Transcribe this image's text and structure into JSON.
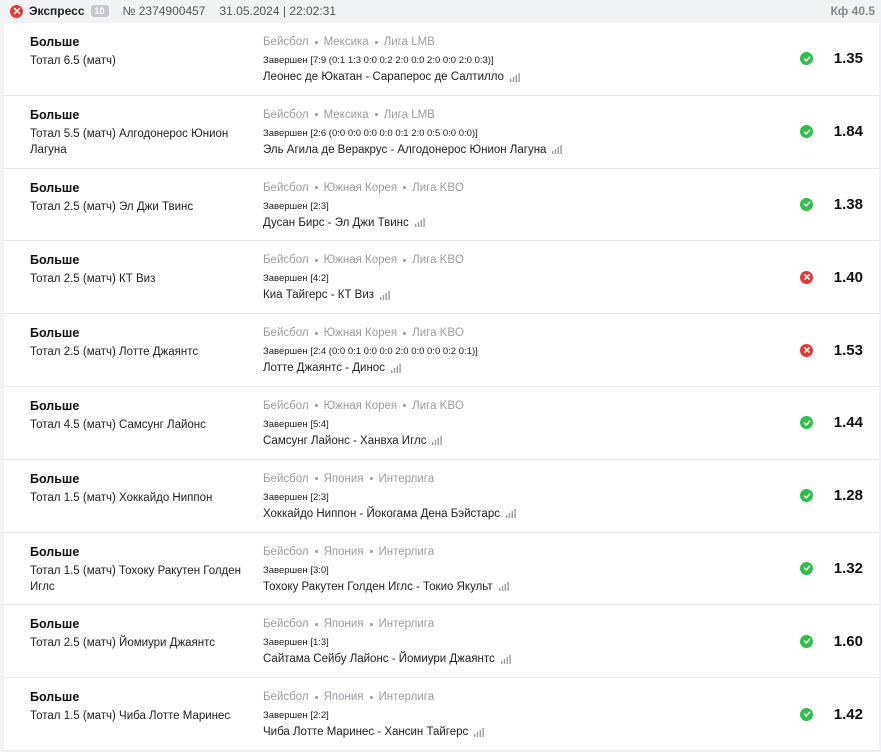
{
  "header": {
    "status": "lost",
    "type": "Экспресс",
    "count": "10",
    "number": "№ 2374900457",
    "datetime": "31.05.2024 | 22:02:31",
    "kf": "Кф 40.5"
  },
  "colors": {
    "won": "#2fbf4a",
    "lost": "#e53935"
  },
  "icons": {
    "won": "check-icon",
    "lost": "cross-icon",
    "stats": "bar-chart-icon"
  },
  "bets": [
    {
      "type": "Больше",
      "desc": "Тотал 6.5 (матч)",
      "sport": "Бейсбол",
      "country": "Мексика",
      "league": "Лига LMB",
      "result": "Завершен [7:9 (0:1 1:3 0:0 0:2 2:0 0:0 2:0 0:0 2:0 0:3)]",
      "teams": "Леонес де Юкатан - Сарaперос де Салтилло",
      "status": "won",
      "coef": "1.35"
    },
    {
      "type": "Больше",
      "desc": "Тотал 5.5 (матч) Алгодонерос Юнион Лагуна",
      "sport": "Бейсбол",
      "country": "Мексика",
      "league": "Лига LMB",
      "result": "Завершен [2:6 (0:0 0:0 0:0 0:0 0:1 2:0 0:5 0:0 0:0)]",
      "teams": "Эль Агила де Веракрус - Алгодонерос Юнион Лагуна",
      "status": "won",
      "coef": "1.84"
    },
    {
      "type": "Больше",
      "desc": "Тотал 2.5 (матч) Эл Джи Твинс",
      "sport": "Бейсбол",
      "country": "Южная Корея",
      "league": "Лига KBO",
      "result": "Завершен [2:3]",
      "teams": "Дусан Бирс - Эл Джи Твинс",
      "status": "won",
      "coef": "1.38"
    },
    {
      "type": "Больше",
      "desc": "Тотал 2.5 (матч) КТ Виз",
      "sport": "Бейсбол",
      "country": "Южная Корея",
      "league": "Лига KBO",
      "result": "Завершен [4:2]",
      "teams": "Киа Тайгерс - КТ Виз",
      "status": "lost",
      "coef": "1.40"
    },
    {
      "type": "Больше",
      "desc": "Тотал 2.5 (матч) Лотте Джаянтс",
      "sport": "Бейсбол",
      "country": "Южная Корея",
      "league": "Лига KBO",
      "result": "Завершен [2:4 (0:0 0:1 0:0 0:0 2:0 0:0 0:0 0:2 0:1)]",
      "teams": "Лотте Джаянтс - Динос",
      "status": "lost",
      "coef": "1.53"
    },
    {
      "type": "Больше",
      "desc": "Тотал 4.5 (матч) Самсунг Лайонс",
      "sport": "Бейсбол",
      "country": "Южная Корея",
      "league": "Лига KBO",
      "result": "Завершен [5:4]",
      "teams": "Самсунг Лайонс - Ханвха Иглс",
      "status": "won",
      "coef": "1.44"
    },
    {
      "type": "Больше",
      "desc": "Тотал 1.5 (матч) Хоккайдо Ниппон",
      "sport": "Бейсбол",
      "country": "Япония",
      "league": "Интерлига",
      "result": "Завершен [2:3]",
      "teams": "Хоккайдо Ниппон - Йокогама Дена Бэйстарс",
      "status": "won",
      "coef": "1.28"
    },
    {
      "type": "Больше",
      "desc": "Тотал 1.5 (матч) Тохоку Ракутен Голден Иглс",
      "sport": "Бейсбол",
      "country": "Япония",
      "league": "Интерлига",
      "result": "Завершен [3:0]",
      "teams": "Тохоку Ракутен Голден Иглс - Токио Якульт",
      "status": "won",
      "coef": "1.32"
    },
    {
      "type": "Больше",
      "desc": "Тотал 2.5 (матч) Йомиури Джаянтс",
      "sport": "Бейсбол",
      "country": "Япония",
      "league": "Интерлига",
      "result": "Завершен [1:3]",
      "teams": "Сайтама Сейбу Лайонс - Йомиури Джаянтс",
      "status": "won",
      "coef": "1.60"
    },
    {
      "type": "Больше",
      "desc": "Тотал 1.5 (матч) Чиба Лотте Маринес",
      "sport": "Бейсбол",
      "country": "Япония",
      "league": "Интерлига",
      "result": "Завершен [2:2]",
      "teams": "Чиба Лотте Маринес - Хансин Тайгерс",
      "status": "won",
      "coef": "1.42"
    }
  ]
}
